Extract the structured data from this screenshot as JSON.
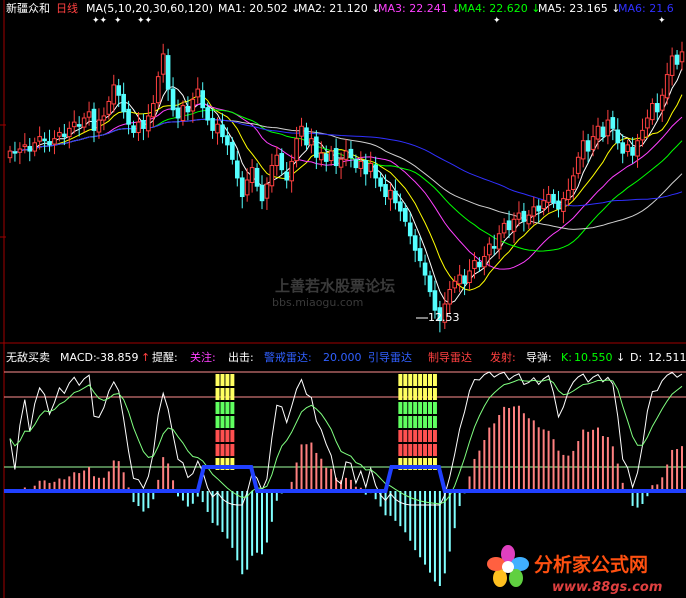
{
  "header": {
    "stock_name": "新疆众和",
    "period": "日线",
    "ma_params": "MA(5,10,20,30,60,120)",
    "items": [
      {
        "label": "MA1:",
        "value": "20.502",
        "arrow": "↓",
        "color": "#ffffff"
      },
      {
        "label": "MA2:",
        "value": "21.120",
        "arrow": "↓",
        "color": "#ffffff"
      },
      {
        "label": "MA3:",
        "value": "22.241",
        "arrow": "↓",
        "color": "#ff40ff"
      },
      {
        "label": "MA4:",
        "value": "22.620",
        "arrow": "↓",
        "color": "#00ff00"
      },
      {
        "label": "MA5:",
        "value": "23.165",
        "arrow": "↓",
        "color": "#ffffff"
      },
      {
        "label": "MA6:",
        "value": "21.6",
        "arrow": "",
        "color": "#3030ff"
      }
    ]
  },
  "indicator_header": {
    "name": "无敌买卖",
    "macd_label": "MACD:",
    "macd_value": "-38.859",
    "macd_arrow": "↑",
    "remind_label": "提醒:",
    "watch_label": "关注:",
    "strike_label": "出击:",
    "radar1": "警戒雷达:",
    "radar1_value": "20.000",
    "radar2": "引导雷达",
    "radar3": "制导雷达",
    "launch": "发射:",
    "missile": "导弹:",
    "k_label": "K:",
    "k_value": "10.550",
    "k_arrow": "↓",
    "d_label": "D:",
    "d_value": "12.511"
  },
  "low_marker": "12.53",
  "watermark": {
    "line1": "上善若水股票论坛",
    "line2": "bbs.miaogu.com"
  },
  "logo": {
    "title": "分析家公式网",
    "url": "www.88gs.com"
  },
  "colors": {
    "up": "#ff4040",
    "down": "#54ffff",
    "ma1": "#ffffff",
    "ma2": "#ffff00",
    "ma3": "#ff40ff",
    "ma4": "#00ff00",
    "ma5": "#d0d0d0",
    "ma6": "#3030ff",
    "macd_pos": "#ff8080",
    "macd_neg": "#80ffff",
    "k": "#ffffff",
    "d": "#80ff80",
    "baseline": "#2040ff",
    "axis": "#c00000"
  },
  "chart_data": {
    "type": "candlestick",
    "price_range": [
      12.0,
      27.0
    ],
    "low": 12.53,
    "close": [
      20.9,
      20.8,
      21.0,
      21.2,
      20.9,
      21.3,
      21.6,
      21.4,
      21.2,
      21.5,
      21.8,
      21.6,
      22.0,
      22.3,
      22.1,
      22.5,
      22.8,
      21.9,
      22.4,
      22.6,
      23.3,
      24.1,
      23.6,
      22.8,
      22.2,
      21.8,
      22.3,
      22.0,
      22.6,
      23.2,
      24.5,
      25.6,
      23.9,
      22.9,
      22.5,
      23.1,
      22.8,
      23.4,
      23.9,
      23.0,
      22.4,
      21.9,
      22.2,
      21.6,
      21.2,
      20.5,
      19.6,
      18.7,
      19.5,
      20.1,
      19.2,
      18.5,
      19.3,
      20.2,
      20.7,
      20.0,
      19.5,
      20.4,
      21.5,
      22.1,
      21.2,
      21.5,
      20.6,
      20.8,
      20.4,
      20.9,
      20.2,
      20.5,
      20.9,
      20.6,
      20.1,
      20.4,
      19.8,
      20.3,
      19.6,
      19.2,
      18.7,
      19.0,
      18.4,
      18.0,
      17.5,
      16.8,
      16.1,
      15.6,
      14.9,
      14.1,
      13.2,
      12.7,
      13.5,
      14.2,
      14.6,
      14.9,
      14.5,
      15.1,
      15.6,
      15.3,
      15.8,
      16.4,
      16.2,
      16.9,
      17.4,
      17.1,
      17.6,
      17.9,
      17.5,
      17.8,
      18.2,
      18.0,
      18.5,
      18.8,
      18.4,
      18.1,
      18.6,
      19.0,
      19.7,
      20.6,
      21.4,
      20.9,
      21.6,
      22.1,
      21.6,
      22.4,
      22.0,
      21.3,
      20.8,
      21.2,
      20.7,
      21.4,
      21.9,
      22.5,
      23.2,
      22.8,
      23.6,
      24.6,
      25.5,
      25.1,
      25.7
    ],
    "ma_series": [
      "MA1",
      "MA2",
      "MA3",
      "MA4",
      "MA5",
      "MA6"
    ],
    "macd_range": [
      -100,
      100
    ],
    "kd_range": [
      0,
      100
    ]
  }
}
